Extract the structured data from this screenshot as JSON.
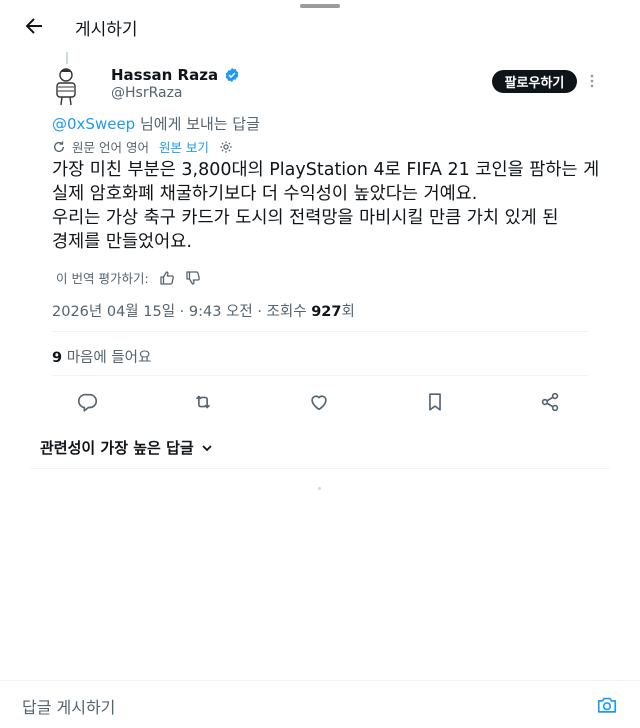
{
  "header": {
    "title": "게시하기",
    "back_icon": "arrow-left-icon"
  },
  "author": {
    "name": "Hassan Raza",
    "handle": "@HsrRaza",
    "verified": true,
    "follow_label": "팔로우하기"
  },
  "reply_context": {
    "mention": "@0xSweep",
    "suffix": " 님에게 보내는 답글"
  },
  "translation": {
    "source_label": "원문 언어 영어",
    "show_original": "원본 보기"
  },
  "post": {
    "lines": [
      "가장 미친 부분은 3,800대의 PlayStation 4로 FIFA 21 코인을 팜하는 게",
      "실제 암호화폐 채굴하기보다 더 수익성이 높았다는 거예요.",
      "우리는 가상 축구 카드가 도시의 전력망을 마비시킬 만큼 가치 있게 된",
      "경제를 만들었어요."
    ]
  },
  "rating": {
    "label": "이 번역 평가하기:"
  },
  "meta": {
    "timestamp": "2026년 04월 15일 · 9:43 오전 · 조회수 ",
    "views": "927",
    "views_suffix": "회"
  },
  "likes": {
    "count": "9",
    "label": " 마음에 들어요"
  },
  "sort": {
    "label": "관련성이 가장 높은 답글"
  },
  "reply_bar": {
    "placeholder": "답글 게시하기"
  },
  "colors": {
    "accent": "#1d9bf0",
    "text": "#0f1419",
    "muted": "#536471",
    "button": "#0f1419"
  }
}
